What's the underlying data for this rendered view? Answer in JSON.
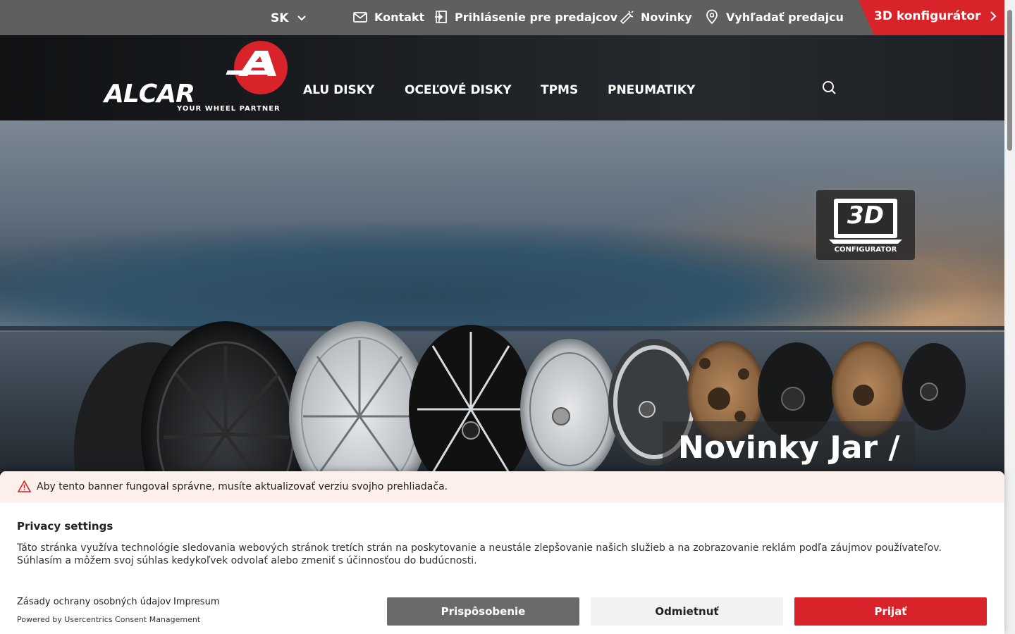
{
  "topbar": {
    "language": "SK",
    "links": [
      {
        "label": "Kontakt",
        "icon": "mail-icon"
      },
      {
        "label": "Prihlásenie pre predajcov",
        "icon": "login-icon"
      },
      {
        "label": "Novinky",
        "icon": "megaphone-icon"
      },
      {
        "label": "Vyhľadať predajcu",
        "icon": "location-pin-icon"
      }
    ],
    "cta_label": "3D konfigurátor"
  },
  "header": {
    "logo_word": "ALCAR",
    "logo_tagline": "YOUR WHEEL PARTNER",
    "nav": [
      "ALU DISKY",
      "OCEĽOVÉ DISKY",
      "TPMS",
      "PNEUMATIKY"
    ]
  },
  "hero": {
    "badge_text": "3D",
    "badge_caption": "CONFIGURATOR",
    "title": "Novinky Jar /"
  },
  "consent": {
    "warning": "Aby tento banner fungoval správne, musíte aktualizovať verziu svojho prehliadača.",
    "title": "Privacy settings",
    "body": "Táto stránka využíva technológie sledovania webových stránok tretích strán na poskytovanie a neustále zlepšovanie našich služieb a na zobrazovanie reklám podľa záujmov používateľov. Súhlasím a môžem svoj súhlas kedykoľvek odvolať alebo zmeniť s účinnosťou do budúcnosti.",
    "privacy_link": "Zásady ochrany osobných údajov",
    "imprint_link": "Impresum",
    "powered_by": "Powered by Usercentrics Consent Management",
    "buttons": {
      "customize": "Prispôsobenie",
      "deny": "Odmietnuť",
      "accept": "Prijať"
    }
  },
  "colors": {
    "brand_red": "#d8232a",
    "topbar": "#5f5f5f"
  }
}
